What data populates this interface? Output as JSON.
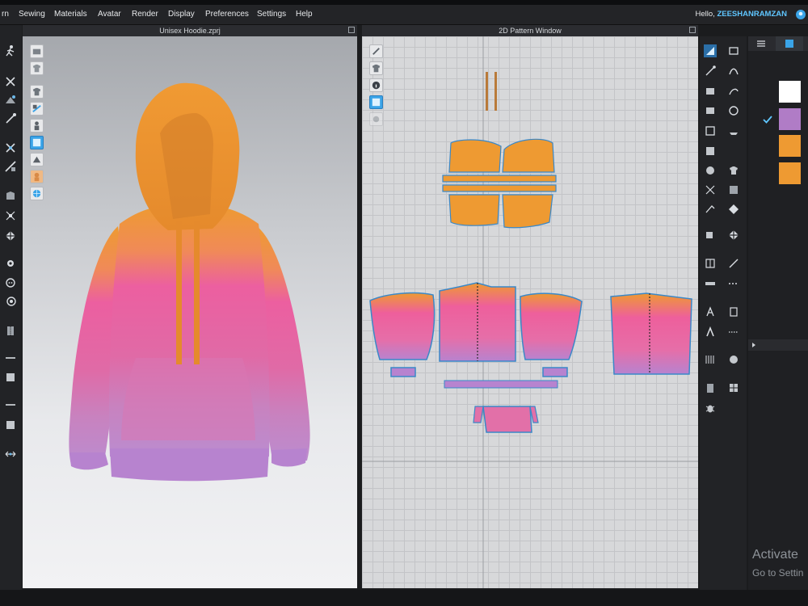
{
  "menu": {
    "items": [
      "rn",
      "Sewing",
      "Materials",
      "Avatar",
      "Render",
      "Display",
      "Preferences",
      "Settings",
      "Help"
    ],
    "greeting_prefix": "Hello,",
    "username": "ZEESHANRAMZAN"
  },
  "windows": {
    "view3d_title": "Unisex Hoodie.zprj",
    "pattern_title": "2D Pattern Window"
  },
  "fabrics": {
    "swatch_colors": [
      "#ffffff",
      "#b07cc6",
      "#ee9a32",
      "#ee9a32"
    ],
    "selected_index": 1
  },
  "watermark": {
    "line1": "Activate",
    "line2": "Go to Settin"
  },
  "colors": {
    "accent": "#3aa4e8",
    "hood_orange": "#ee9a32",
    "body_pink": "#ec5fa0",
    "cuff_purple": "#b783cf"
  }
}
